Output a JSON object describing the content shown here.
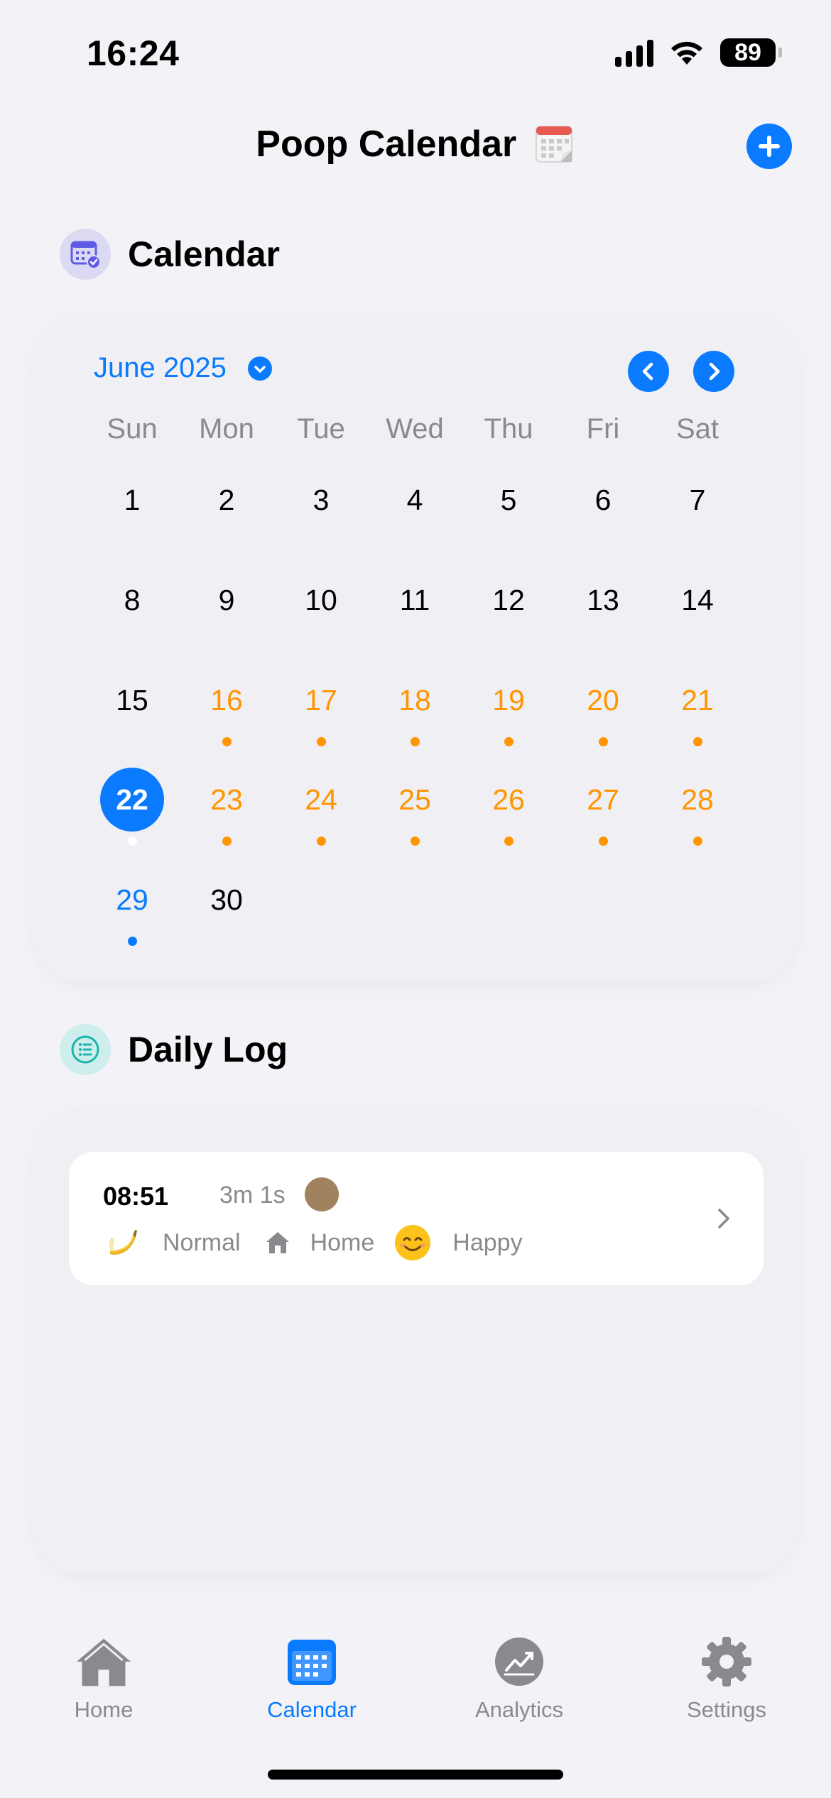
{
  "status_bar": {
    "time": "16:24",
    "battery": "89"
  },
  "nav": {
    "title": "Poop Calendar"
  },
  "calendar_section": {
    "title": "Calendar",
    "month_label": "June 2025",
    "weekdays": [
      "Sun",
      "Mon",
      "Tue",
      "Wed",
      "Thu",
      "Fri",
      "Sat"
    ],
    "weeks": [
      [
        "1",
        "2",
        "3",
        "4",
        "5",
        "6",
        "7"
      ],
      [
        "8",
        "9",
        "10",
        "11",
        "12",
        "13",
        "14"
      ],
      [
        "15",
        "16",
        "17",
        "18",
        "19",
        "20",
        "21"
      ],
      [
        "22",
        "23",
        "24",
        "25",
        "26",
        "27",
        "28"
      ],
      [
        "29",
        "30"
      ]
    ],
    "selected_day": "22",
    "today": "29",
    "logged_days": [
      "16",
      "17",
      "18",
      "19",
      "20",
      "21",
      "22",
      "23",
      "24",
      "25",
      "26",
      "27",
      "28",
      "29"
    ]
  },
  "daily_log_section": {
    "title": "Daily Log",
    "entries": [
      {
        "time": "08:51",
        "duration": "3m 1s",
        "stool_color": "#a0835e",
        "consistency": "Normal",
        "consistency_icon": "banana-icon",
        "location": "Home",
        "location_icon": "house-icon",
        "mood": "Happy",
        "mood_icon": "smiling-face-icon"
      }
    ]
  },
  "tab_bar": {
    "tabs": [
      {
        "label": "Home",
        "icon": "house-icon",
        "active": false
      },
      {
        "label": "Calendar",
        "icon": "calendar-icon",
        "active": true
      },
      {
        "label": "Analytics",
        "icon": "chart-icon",
        "active": false
      },
      {
        "label": "Settings",
        "icon": "gear-icon",
        "active": false
      }
    ]
  },
  "colors": {
    "accent": "#0a7aff",
    "streak": "#ff9500",
    "background": "#f2f2f7",
    "secondary_text": "#8a8a8e"
  }
}
